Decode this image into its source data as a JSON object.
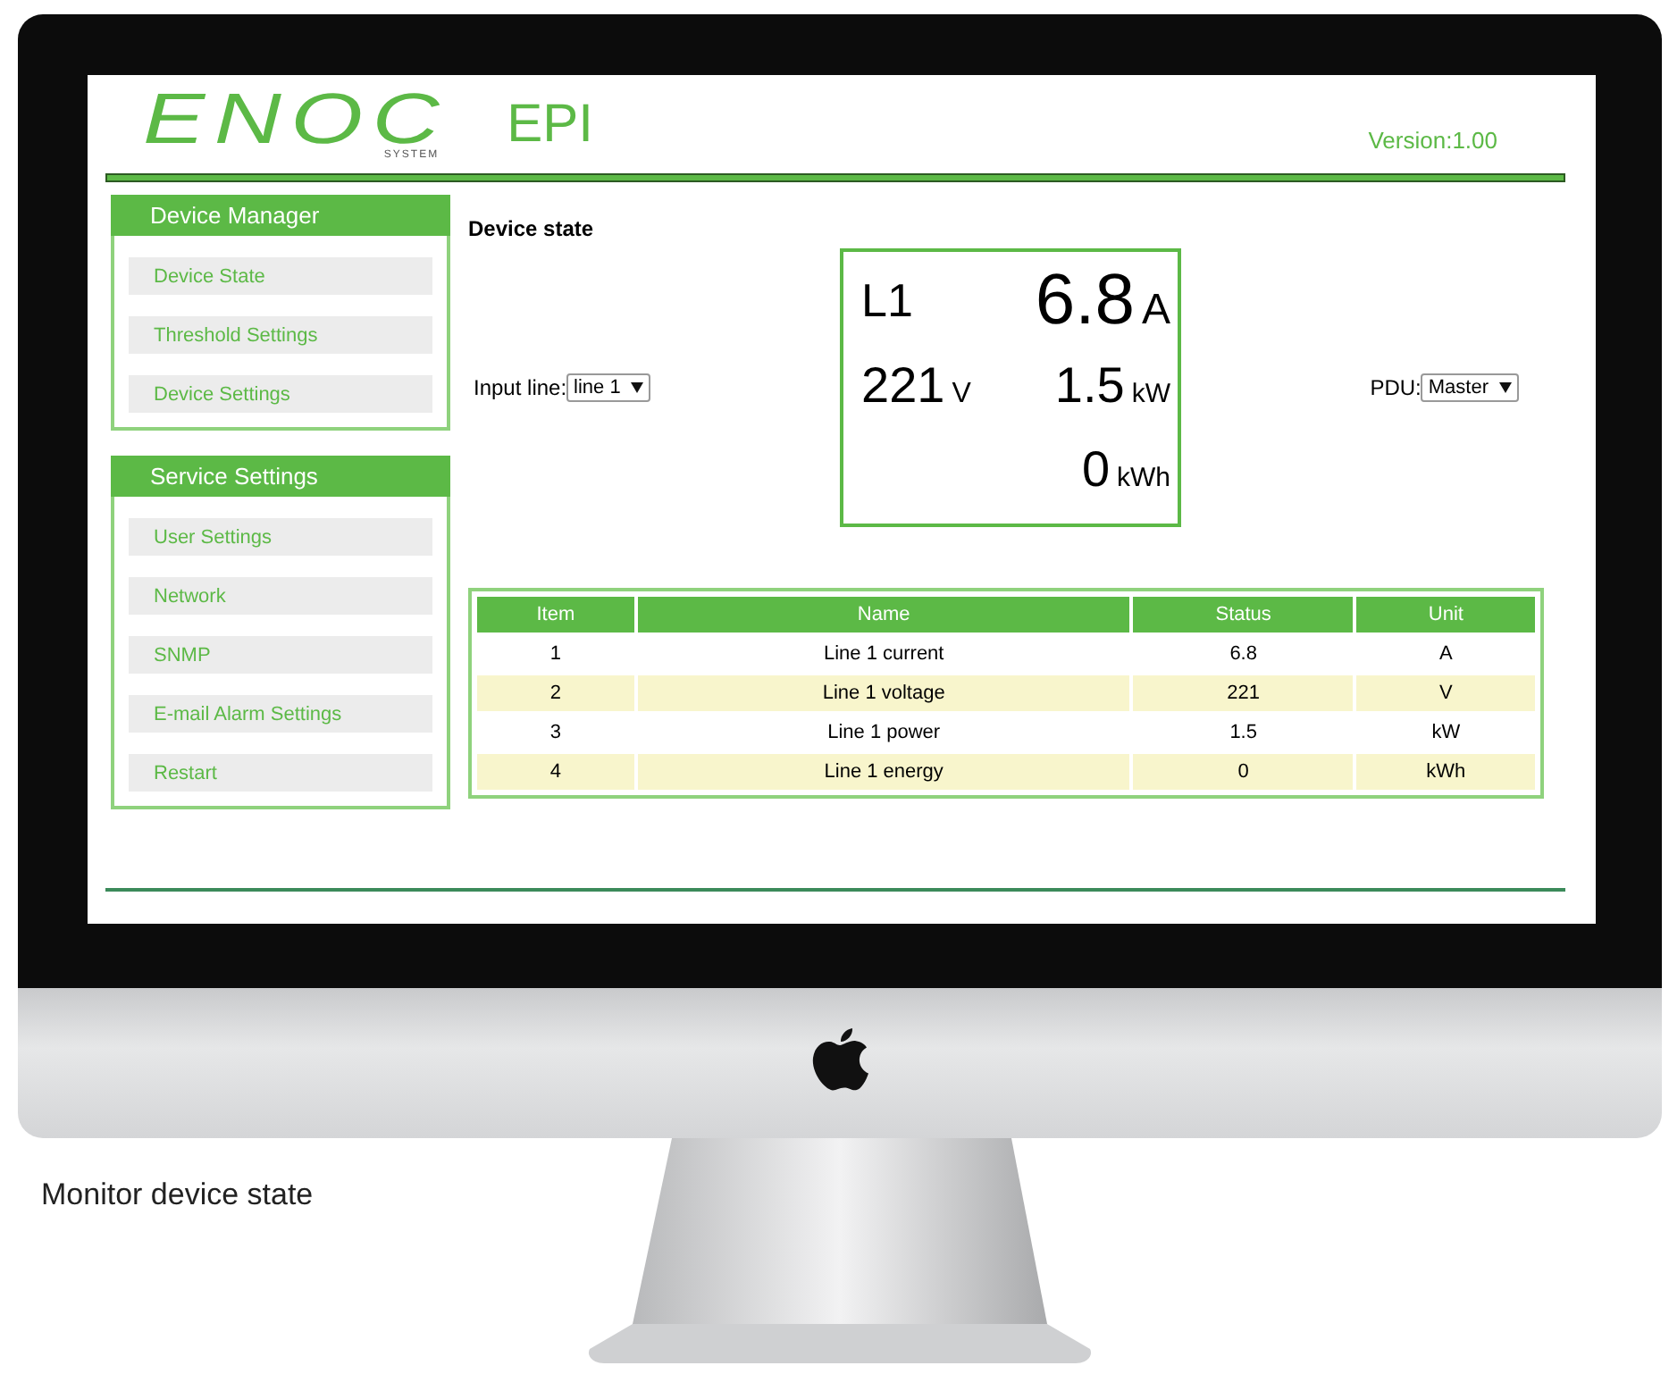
{
  "logo": {
    "name": "ENOC",
    "tagline": "SYSTEM"
  },
  "app_title": "EPI",
  "version": "Version:1.00",
  "sidebar": [
    {
      "title": "Device Manager",
      "items": [
        {
          "label": "Device State",
          "selected": false
        },
        {
          "label": "Threshold Settings",
          "selected": false
        },
        {
          "label": "Device Settings",
          "selected": false
        }
      ]
    },
    {
      "title": "Service Settings",
      "items": [
        {
          "label": "User Settings",
          "selected": false
        },
        {
          "label": "Network",
          "selected": false
        },
        {
          "label": "SNMP",
          "selected": false
        },
        {
          "label": "E-mail Alarm Settings",
          "selected": false
        },
        {
          "label": "Restart",
          "selected": false
        }
      ]
    }
  ],
  "page_title": "Device state",
  "input_line": {
    "label": "Input line:",
    "value": "line 1"
  },
  "pdu": {
    "label": "PDU:",
    "value": "Master"
  },
  "gauge": {
    "line": "L1",
    "current": {
      "value": "6.8",
      "unit": "A"
    },
    "voltage": {
      "value": "221",
      "unit": "V"
    },
    "power": {
      "value": "1.5",
      "unit": "kW"
    },
    "energy": {
      "value": "0",
      "unit": "kWh"
    }
  },
  "table": {
    "columns": [
      "Item",
      "Name",
      "Status",
      "Unit"
    ],
    "rows": [
      [
        "1",
        "Line 1 current",
        "6.8",
        "A"
      ],
      [
        "2",
        "Line 1 voltage",
        "221",
        "V"
      ],
      [
        "3",
        "Line 1 power",
        "1.5",
        "kW"
      ],
      [
        "4",
        "Line 1 energy",
        "0",
        "kWh"
      ]
    ]
  },
  "caption": "Monitor device state"
}
